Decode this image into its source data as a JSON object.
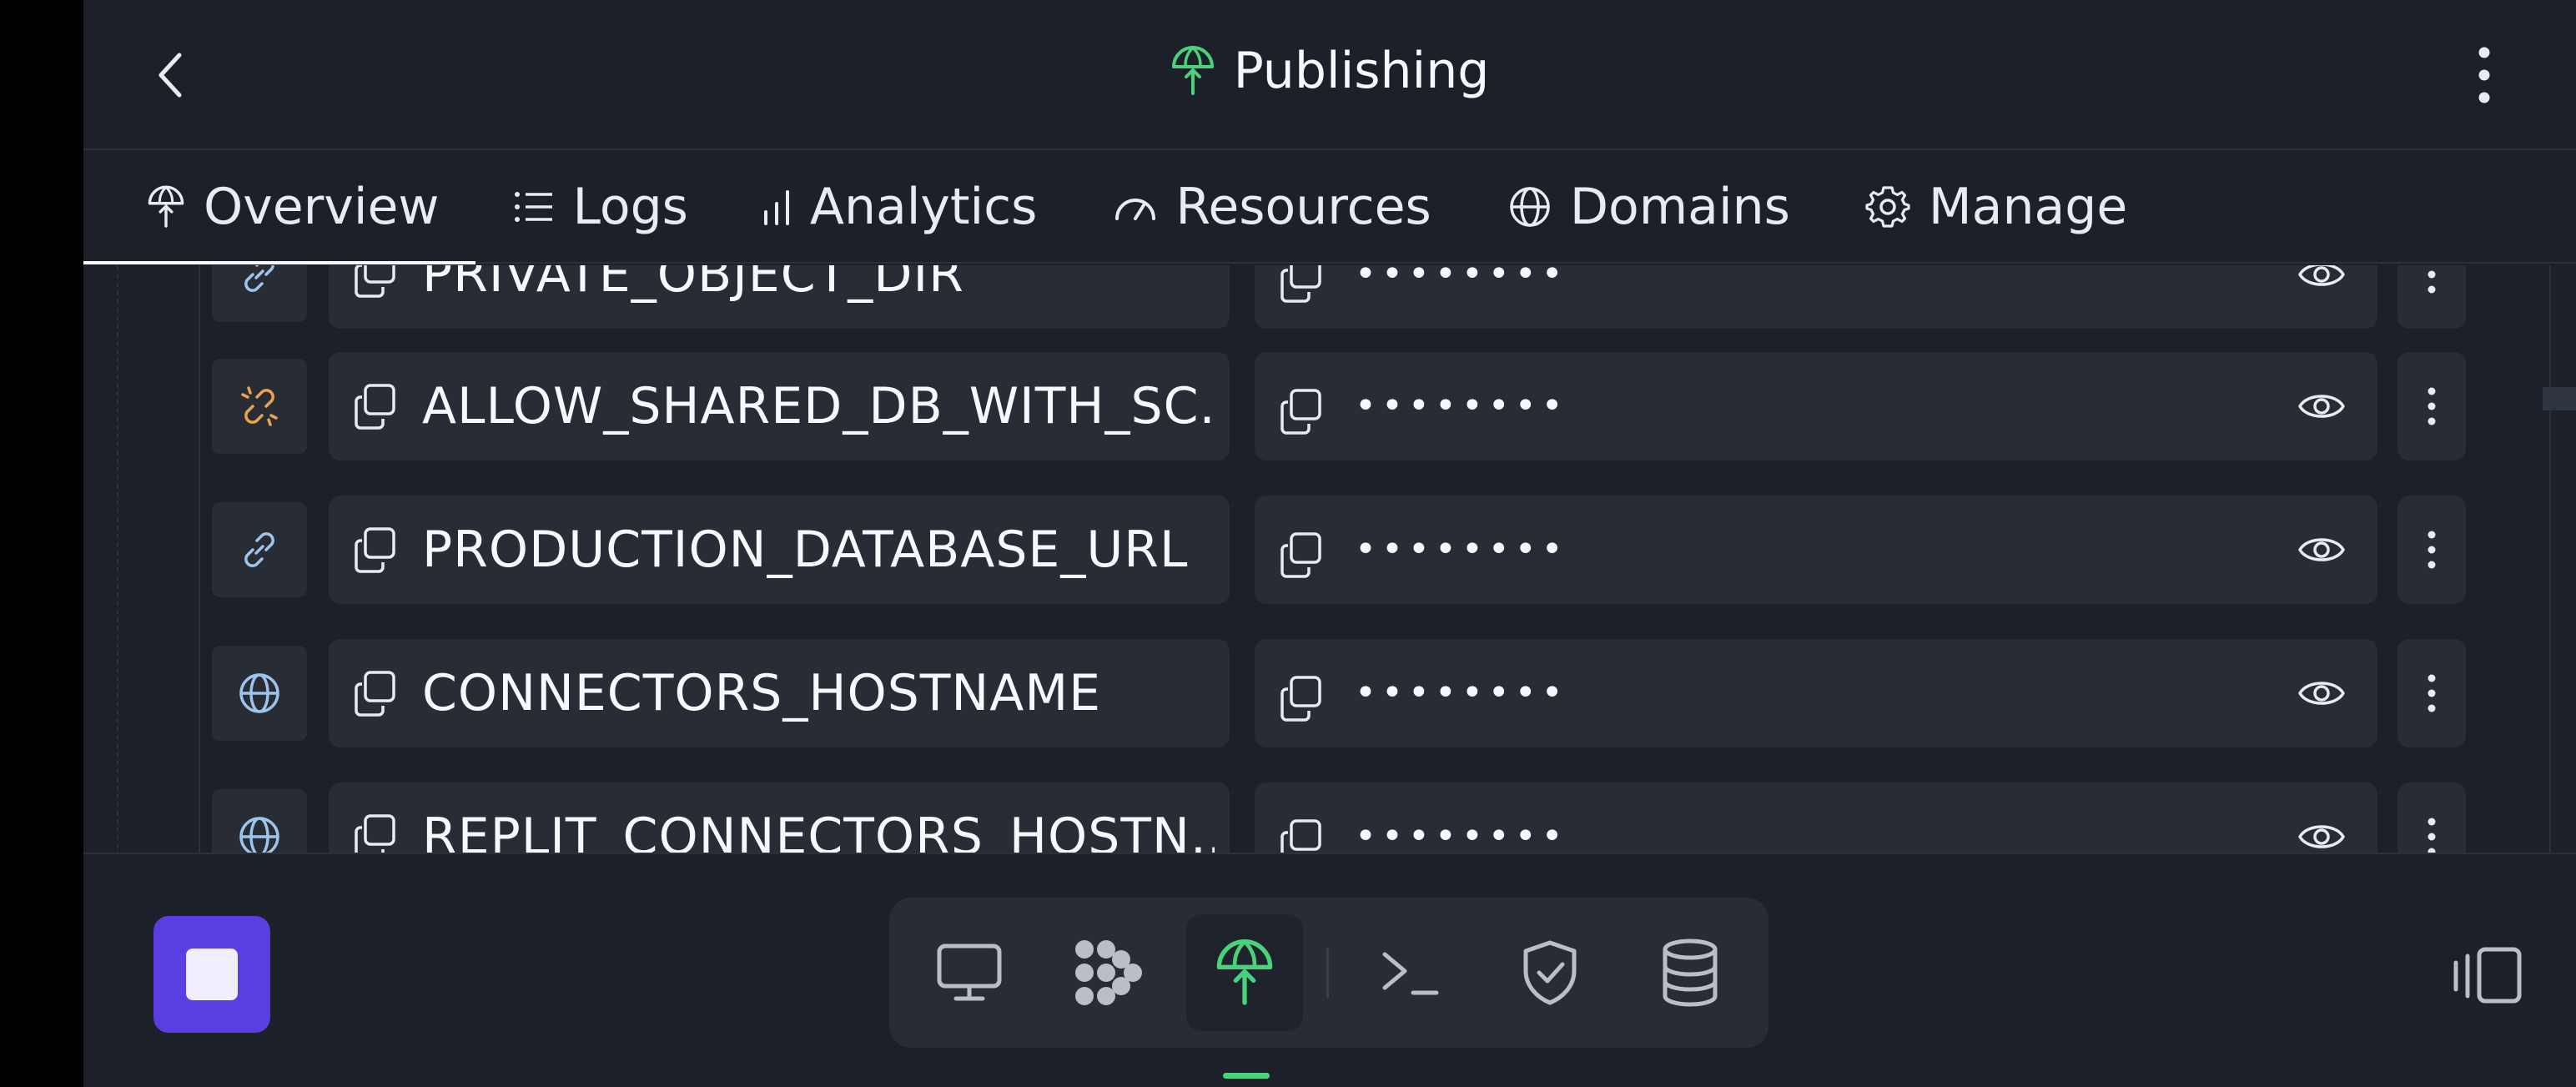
{
  "header": {
    "title": "Publishing",
    "accent_color": "#4ad17c"
  },
  "tabs": [
    {
      "label": "Overview",
      "icon": "publish-icon",
      "active": true
    },
    {
      "label": "Logs",
      "icon": "list-icon",
      "active": false
    },
    {
      "label": "Analytics",
      "icon": "bar-chart-icon",
      "active": false
    },
    {
      "label": "Resources",
      "icon": "gauge-icon",
      "active": false
    },
    {
      "label": "Domains",
      "icon": "globe-icon",
      "active": false
    },
    {
      "label": "Manage",
      "icon": "gear-icon",
      "active": false
    }
  ],
  "secrets": [
    {
      "key": "PRIVATE_OBJECT_DIR",
      "value": "••••••••",
      "type_icon": "link-icon"
    },
    {
      "key": "ALLOW_SHARED_DB_WITH_SC...",
      "value": "••••••••",
      "type_icon": "broken-link-icon"
    },
    {
      "key": "PRODUCTION_DATABASE_URL",
      "value": "••••••••",
      "type_icon": "link-icon"
    },
    {
      "key": "CONNECTORS_HOSTNAME",
      "value": "••••••••",
      "type_icon": "globe-icon"
    },
    {
      "key": "REPLIT_CONNECTORS_HOSTN...",
      "value": "••••••••",
      "type_icon": "globe-icon"
    }
  ],
  "bottom_tools": [
    {
      "name": "preview-tool",
      "icon": "monitor-icon"
    },
    {
      "name": "workflows-tool",
      "icon": "nodes-icon"
    },
    {
      "name": "publishing-tool",
      "icon": "publish-icon",
      "active": true
    },
    {
      "name": "shell-tool",
      "icon": "terminal-icon"
    },
    {
      "name": "security-tool",
      "icon": "shield-check-icon"
    },
    {
      "name": "database-tool",
      "icon": "database-icon"
    }
  ],
  "colors": {
    "background": "#1c2028",
    "surface": "#272c35",
    "stop_button": "#5b3ee0",
    "broken_link": "#f0a14e",
    "link_blue": "#9dc4ec"
  }
}
